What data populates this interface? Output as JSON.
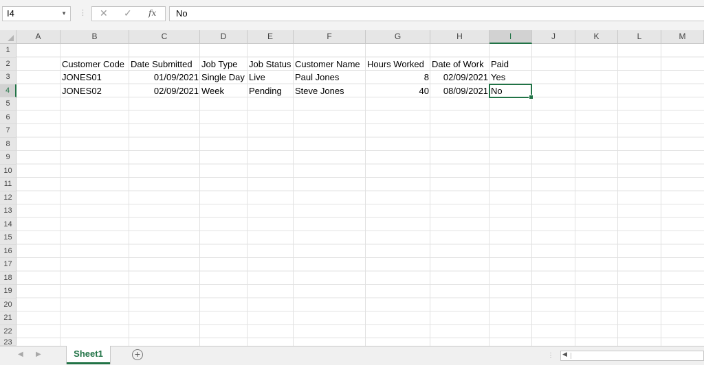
{
  "formula_bar": {
    "name_box": "I4",
    "formula_value": "No",
    "cancel_glyph": "✕",
    "enter_glyph": "✓",
    "fx_label": "fx"
  },
  "columns": [
    "A",
    "B",
    "C",
    "D",
    "E",
    "F",
    "G",
    "H",
    "I",
    "J",
    "K",
    "L",
    "M"
  ],
  "rows": [
    "1",
    "2",
    "3",
    "4",
    "5",
    "6",
    "7",
    "8",
    "9",
    "10",
    "11",
    "12",
    "13",
    "14",
    "15",
    "16",
    "17",
    "18",
    "19",
    "20",
    "21",
    "22",
    "23"
  ],
  "table": {
    "headers": [
      "Customer Code",
      "Date Submitted",
      "Job Type",
      "Job Status",
      "Customer Name",
      "Hours Worked",
      "Date of Work",
      "Paid"
    ],
    "rows": [
      [
        "JONES01",
        "01/09/2021",
        "Single Day",
        "Live",
        "Paul Jones",
        "8",
        "02/09/2021",
        "Yes"
      ],
      [
        "JONES02",
        "02/09/2021",
        "Week",
        "Pending",
        "Steve Jones",
        "40",
        "08/09/2021",
        "No"
      ]
    ]
  },
  "selection": {
    "cell": "I4",
    "column": "I",
    "row": "4"
  },
  "sheet_tabs": [
    {
      "label": "Sheet1",
      "active": true
    }
  ],
  "icons": {
    "add_sheet": "plus-circle-icon",
    "nav_prev": "triangle-left-icon",
    "nav_next": "triangle-right-icon",
    "name_box_dropdown": "chevron-down-icon"
  },
  "colors": {
    "accent": "#217346",
    "header_bg": "#e6e6e6",
    "gridline": "#e1e1e1"
  }
}
